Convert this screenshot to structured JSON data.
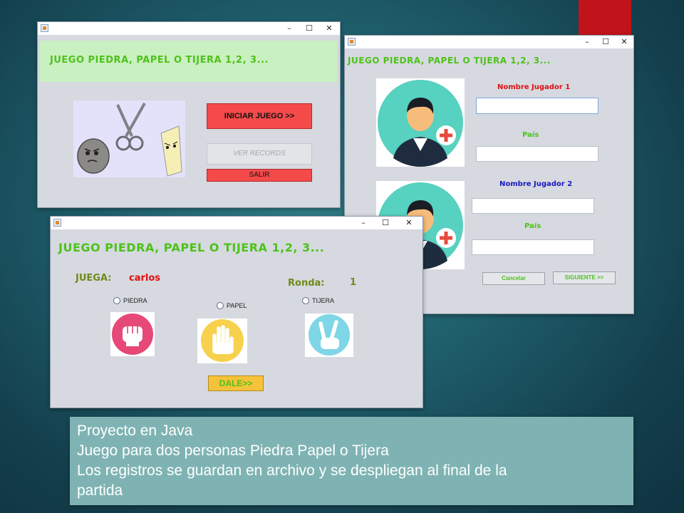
{
  "window_controls": {
    "minimize": "–",
    "maximize": "☐",
    "close": "✕"
  },
  "window1": {
    "title": "JUEGO PIEDRA, PAPEL O TIJERA 1,2, 3...",
    "start_button": "INICIAR JUEGO >>",
    "records_button": "VER RECORDS",
    "exit_button": "SALIR"
  },
  "window2": {
    "title": "JUEGO PIEDRA, PAPEL O TIJERA 1,2, 3...",
    "player1_label": "Nombre Jugador 1",
    "country1_label": "País",
    "player2_label": "Nombre Jugador 2",
    "country2_label": "País",
    "player1_value": "",
    "country1_value": "",
    "player2_value": "",
    "country2_value": "",
    "cancel_button": "Cancelar",
    "next_button": "SIGUIENTE >>"
  },
  "window3": {
    "title": "JUEGO PIEDRA, PAPEL O TIJERA 1,2, 3...",
    "plays_label": "JUEGA:",
    "player_name": "carlos",
    "round_label": "Ronda:",
    "round_value": "1",
    "options": [
      "PIEDRA",
      "PAPEL",
      "TIJERA"
    ],
    "go_button": "DALE>>"
  },
  "caption": {
    "lines": [
      "Proyecto en Java",
      "Juego para dos personas Piedra Papel o Tijera",
      "Los registros se guardan en archivo y se despliegan al final de la",
      "partida"
    ]
  },
  "colors": {
    "accent_green": "#4dc21a",
    "button_red": "#f44a4a",
    "label_red": "#e01010",
    "label_blue": "#1818c0",
    "go_yellow": "#f5c23a",
    "olive": "#6f8a1a"
  }
}
